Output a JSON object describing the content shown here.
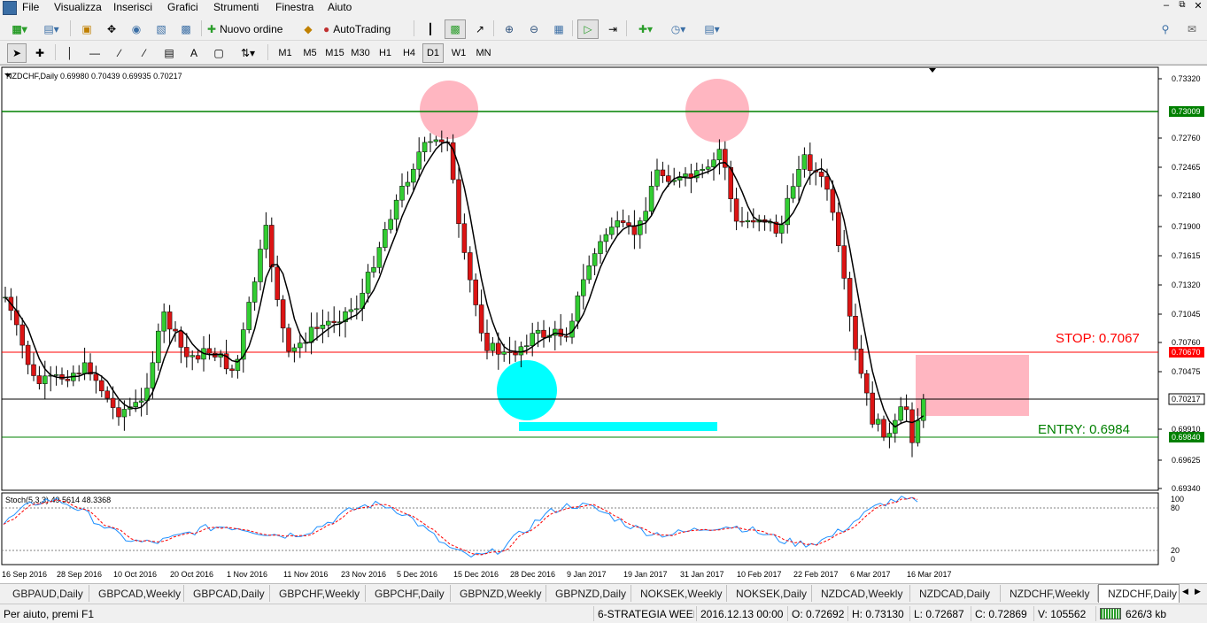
{
  "menu": [
    "File",
    "Visualizza",
    "Inserisci",
    "Grafici",
    "Strumenti",
    "Finestra",
    "Aiuto"
  ],
  "toolbar1": {
    "new_order": "Nuovo ordine",
    "autotrading": "AutoTrading"
  },
  "timeframes": [
    "M1",
    "M5",
    "M15",
    "M30",
    "H1",
    "H4",
    "D1",
    "W1",
    "MN"
  ],
  "active_timeframe": "D1",
  "chart": {
    "header": "NZDCHF,Daily  0.69980 0.70439 0.69935 0.70217",
    "stop_label": "STOP: 0.7067",
    "entry_label": "ENTRY: 0.6984",
    "price_ticks": [
      "0.73320",
      "0.72760",
      "0.72465",
      "0.72180",
      "0.71900",
      "0.71615",
      "0.71320",
      "0.71045",
      "0.70760",
      "0.70475",
      "0.69910",
      "0.69625",
      "0.69340"
    ],
    "marker_resistance": "0.73009",
    "marker_stop": "0.70670",
    "marker_current": "0.70217",
    "marker_entry": "0.69840",
    "stoch_header": "Stoch(5,3,3) 49.5614 48.3368",
    "stoch_ticks": [
      "100",
      "80",
      "20",
      "0"
    ],
    "date_ticks": [
      "16 Sep 2016",
      "28 Sep 2016",
      "10 Oct 2016",
      "20 Oct 2016",
      "1 Nov 2016",
      "11 Nov 2016",
      "23 Nov 2016",
      "5 Dec 2016",
      "15 Dec 2016",
      "28 Dec 2016",
      "9 Jan 2017",
      "19 Jan 2017",
      "31 Jan 2017",
      "10 Feb 2017",
      "22 Feb 2017",
      "6 Mar 2017",
      "16 Mar 2017"
    ],
    "colors": {
      "bull": "#32cd32",
      "bear": "#dc1414",
      "resistance": "#008000",
      "stop_line": "#ff0000",
      "entry_line": "#008000",
      "top_circle": "#ffb6c1",
      "bottom_circle": "#00ffff",
      "zone": "#ffb6c1"
    }
  },
  "chart_data": {
    "type": "candlestick",
    "title": "NZDCHF,Daily",
    "ohlc_current": {
      "open": 0.6998,
      "high": 0.70439,
      "low": 0.69935,
      "close": 0.70217
    },
    "levels": {
      "resistance": 0.73009,
      "stop": 0.7067,
      "current": 0.70217,
      "entry": 0.6984
    },
    "ylim": [
      0.692,
      0.734
    ],
    "stochastic": {
      "params": "5,3,3",
      "main": 49.5614,
      "signal": 48.3368,
      "levels": [
        80,
        20
      ],
      "ylim": [
        0,
        100
      ]
    }
  },
  "tabs": [
    "GBPAUD,Daily",
    "GBPCAD,Weekly",
    "GBPCAD,Daily",
    "GBPCHF,Weekly",
    "GBPCHF,Daily",
    "GBPNZD,Weekly",
    "GBPNZD,Daily",
    "NOKSEK,Weekly",
    "NOKSEK,Daily",
    "NZDCAD,Weekly",
    "NZDCAD,Daily",
    "NZDCHF,Weekly",
    "NZDCHF,Daily"
  ],
  "status": {
    "help": "Per aiuto, premi F1",
    "profile": "6-STRATEGIA WEEKL",
    "datetime": "2016.12.13 00:00",
    "open": "O: 0.72692",
    "high": "H: 0.73130",
    "low": "L: 0.72687",
    "close": "C: 0.72869",
    "volume": "V: 105562",
    "traffic": "626/3 kb"
  }
}
